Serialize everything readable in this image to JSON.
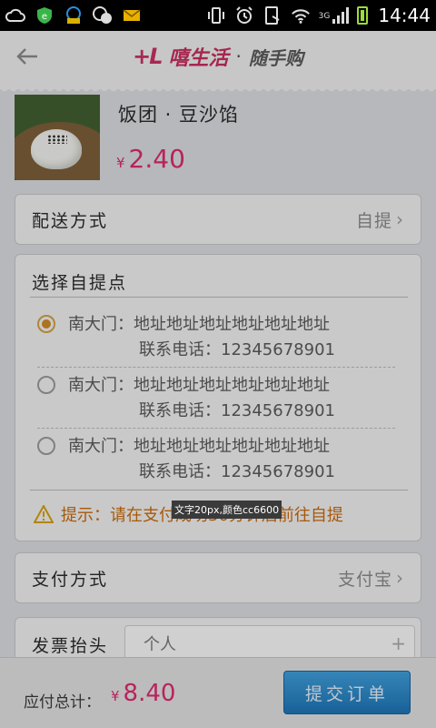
{
  "status_bar": {
    "time": "14:44",
    "network": "3G",
    "icons": [
      "cloud-icon",
      "shield-icon",
      "download-icon",
      "wechat-icon",
      "mail-icon",
      "vibrate-icon",
      "alarm-icon",
      "screenshot-icon",
      "wifi-icon",
      "signal-icon",
      "battery-icon"
    ]
  },
  "header": {
    "back_icon": "arrow-left-icon",
    "brand_logo": "+L",
    "brand_name": "嘻生活",
    "brand_sep": "·",
    "brand_sub": "随手购"
  },
  "product": {
    "name": "饭团 · 豆沙馅",
    "currency": "¥",
    "price": "2.40"
  },
  "delivery": {
    "label": "配送方式",
    "value": "自提"
  },
  "pickup": {
    "title": "选择自提点",
    "options": [
      {
        "name_address": "南大门：地址地址地址地址地址地址",
        "phone": "联系电话：12345678901",
        "selected": true
      },
      {
        "name_address": "南大门：地址地址地址地址地址地址",
        "phone": "联系电话：12345678901",
        "selected": false
      },
      {
        "name_address": "南大门：地址地址地址地址地址地址",
        "phone": "联系电话：12345678901",
        "selected": false
      }
    ],
    "tip": "提示：请在支付成功30分钟后前往自提",
    "tip_note": "文字20px,颜色cc6600"
  },
  "payment": {
    "label": "支付方式",
    "value": "支付宝"
  },
  "invoice": {
    "label": "发票抬头",
    "placeholder": "个人"
  },
  "footer": {
    "total_label": "应付总计：",
    "currency": "¥",
    "total": "8.40",
    "submit_label": "提交订单"
  },
  "colors": {
    "price": "#e0226b",
    "tip": "#cc6600",
    "submit": "#1a85cc",
    "radio_selected": "#d08a1e"
  }
}
